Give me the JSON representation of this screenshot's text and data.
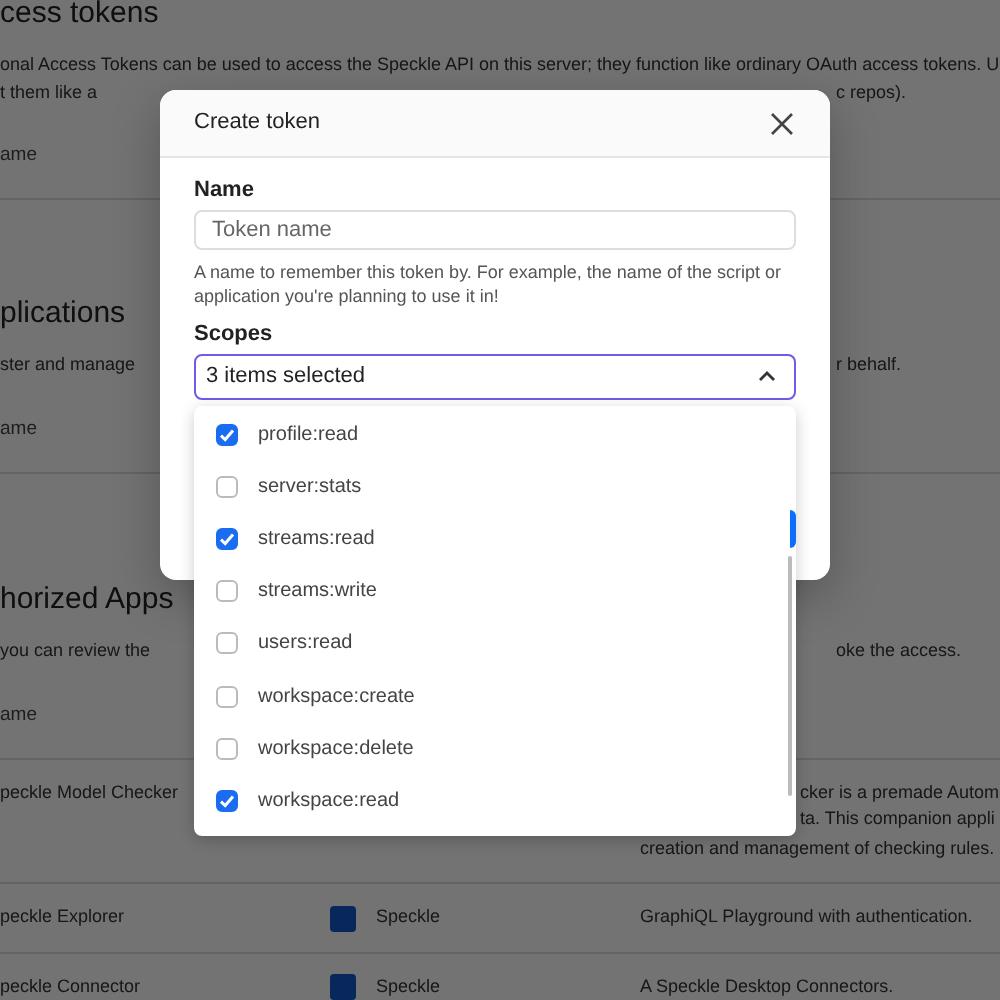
{
  "page": {
    "sections": [
      {
        "heading": "cess tokens",
        "text_lines": [
          {
            "left": "onal Access Tokens can be used to access the Speckle API on this server; they function like ordinary OAuth access tokens. U"
          },
          {
            "left": "t them like a",
            "right": "c repos)."
          }
        ],
        "column_header": "ame"
      },
      {
        "heading": "plications",
        "text_lines": [
          {
            "left": "ster and manage",
            "right": "r behalf."
          }
        ],
        "column_header": "ame"
      },
      {
        "heading": "horized Apps",
        "text_lines": [
          {
            "left": "you can review the",
            "right": "oke the access."
          }
        ],
        "column_header": "ame",
        "rows": [
          {
            "name": "peckle Model Checker",
            "description_lines": [
              "cker is a premade Autom",
              "ta. This companion appli",
              "creation and management of checking rules."
            ]
          },
          {
            "name": "peckle Explorer",
            "author": "Speckle",
            "description_lines": [
              "GraphiQL Playground with authentication."
            ]
          },
          {
            "name": "peckle Connector",
            "author": "Speckle",
            "description_lines": [
              "A Speckle Desktop Connectors."
            ]
          }
        ]
      }
    ]
  },
  "dialog": {
    "title": "Create token",
    "name_field": {
      "label": "Name",
      "placeholder": "Token name",
      "help": "A name to remember this token by. For example, the name of the script or application you're planning to use it in!"
    },
    "scopes_field": {
      "label": "Scopes",
      "value": "3 items selected",
      "expanded": true,
      "options": [
        {
          "label": "profile:read",
          "checked": true
        },
        {
          "label": "server:stats",
          "checked": false
        },
        {
          "label": "streams:read",
          "checked": true
        },
        {
          "label": "streams:write",
          "checked": false
        },
        {
          "label": "users:read",
          "checked": false
        },
        {
          "label": "workspace:create",
          "checked": false
        },
        {
          "label": "workspace:delete",
          "checked": false
        },
        {
          "label": "workspace:read",
          "checked": true
        }
      ]
    }
  }
}
